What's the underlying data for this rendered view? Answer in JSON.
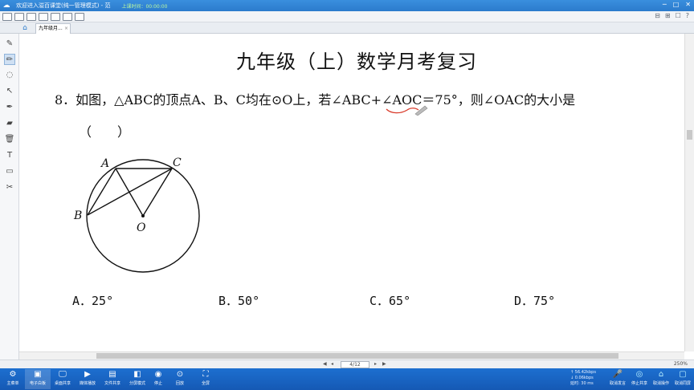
{
  "window": {
    "title": "欢迎进入溢百课堂(纯一管理模式) - 范",
    "status": "上课时间：00:00:00",
    "controls": [
      "─",
      "□",
      "✕"
    ]
  },
  "toolbar": {
    "right_icons": [
      "⊟",
      "⊞",
      "☐",
      "?"
    ]
  },
  "tabs": [
    {
      "label": "九年级月..."
    }
  ],
  "tools": [
    {
      "name": "pen-icon",
      "glyph": "✎"
    },
    {
      "name": "highlighter-icon",
      "glyph": "✏"
    },
    {
      "name": "lasso-icon",
      "glyph": "◌"
    },
    {
      "name": "pointer-icon",
      "glyph": "↖"
    },
    {
      "name": "color-pen-icon",
      "glyph": "✒"
    },
    {
      "name": "eraser-icon",
      "glyph": "▰"
    },
    {
      "name": "trash-icon",
      "glyph": "🗑"
    },
    {
      "name": "text-icon",
      "glyph": "T"
    },
    {
      "name": "image-icon",
      "glyph": "▭"
    },
    {
      "name": "scissors-icon",
      "glyph": "✂"
    }
  ],
  "content": {
    "title": "九年级（上）数学月考复习",
    "question": "8．如图，△ABC的顶点A、B、C均在⊙O上，若∠ABC+∠AOC＝75°，则∠OAC的大小是",
    "paren": "（　　）",
    "options": [
      {
        "label": "A．25°"
      },
      {
        "label": "B．50°"
      },
      {
        "label": "C．65°"
      },
      {
        "label": "D．75°"
      }
    ],
    "figure": {
      "labels": {
        "A": "A",
        "B": "B",
        "C": "C",
        "O": "O"
      }
    },
    "ink_color": "#d93a2a"
  },
  "pagenav": {
    "page": "4/12",
    "zoom": "250%"
  },
  "taskbar": {
    "left": [
      {
        "label": "主菜单",
        "icon": "⚙"
      },
      {
        "label": "电子白板",
        "icon": "▣"
      },
      {
        "label": "桌面共享",
        "icon": "🖵"
      },
      {
        "label": "媒体播放",
        "icon": "▶"
      },
      {
        "label": "文件共享",
        "icon": "▤"
      },
      {
        "label": "分屏模式",
        "icon": "◧"
      },
      {
        "label": "停止",
        "icon": "◉"
      },
      {
        "label": "回放",
        "icon": "⊙"
      },
      {
        "label": "全屏",
        "icon": "⛶"
      }
    ],
    "net": [
      "↑ 56.42kbps",
      "↓ 0.06kbps",
      "延时: 30 ms"
    ],
    "right": [
      {
        "label": "取消发言",
        "icon": "🎤"
      },
      {
        "label": "停止共享",
        "icon": "◎"
      },
      {
        "label": "取消操作",
        "icon": "⌂"
      },
      {
        "label": "取消同屏",
        "icon": "▢"
      }
    ]
  }
}
